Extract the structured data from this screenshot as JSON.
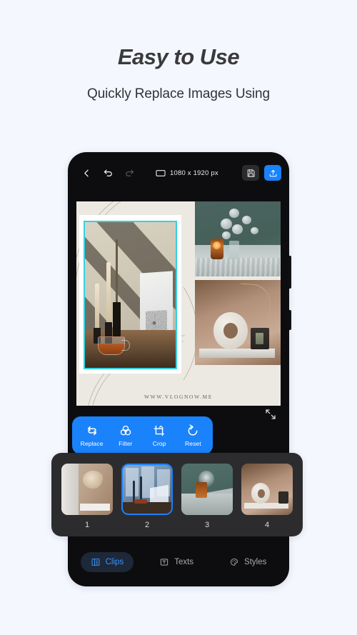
{
  "promo": {
    "headline": "Easy to Use",
    "subhead": "Quickly Replace Images Using"
  },
  "colors": {
    "page_bg": "#f4f7fe",
    "accent_blue": "#1a82fb",
    "phone_body": "#0d0d0f",
    "panel": "#2c2c2e",
    "selection_cyan": "#34d2e0",
    "canvas_bg": "#ece9e2"
  },
  "topbar": {
    "back_icon": "chevron-left-icon",
    "undo_icon": "undo-icon",
    "redo_icon": "redo-icon",
    "canvas_icon": "canvas-size-icon",
    "dimensions": "1080 x 1920 px",
    "save_icon": "floppy-save-icon",
    "export_icon": "export-upload-icon"
  },
  "canvas": {
    "watermark": "WWW.VLOGNOW.ME",
    "expand_icon": "fullscreen-expand-icon",
    "selected_clip": 2
  },
  "actionbar": {
    "items": [
      {
        "label": "Replace",
        "icon": "replace-swap-icon"
      },
      {
        "label": "Filter",
        "icon": "filter-circles-icon"
      },
      {
        "label": "Crop",
        "icon": "crop-rotate-icon"
      },
      {
        "label": "Reset",
        "icon": "reset-undo-circle-icon"
      }
    ]
  },
  "clips": {
    "items": [
      {
        "number": "1",
        "selected": false
      },
      {
        "number": "2",
        "selected": true
      },
      {
        "number": "3",
        "selected": false
      },
      {
        "number": "4",
        "selected": false
      }
    ]
  },
  "tabs": [
    {
      "label": "Clips",
      "icon": "clips-icon",
      "active": true
    },
    {
      "label": "Texts",
      "icon": "text-box-icon",
      "active": false
    },
    {
      "label": "Styles",
      "icon": "palette-icon",
      "active": false
    }
  ]
}
